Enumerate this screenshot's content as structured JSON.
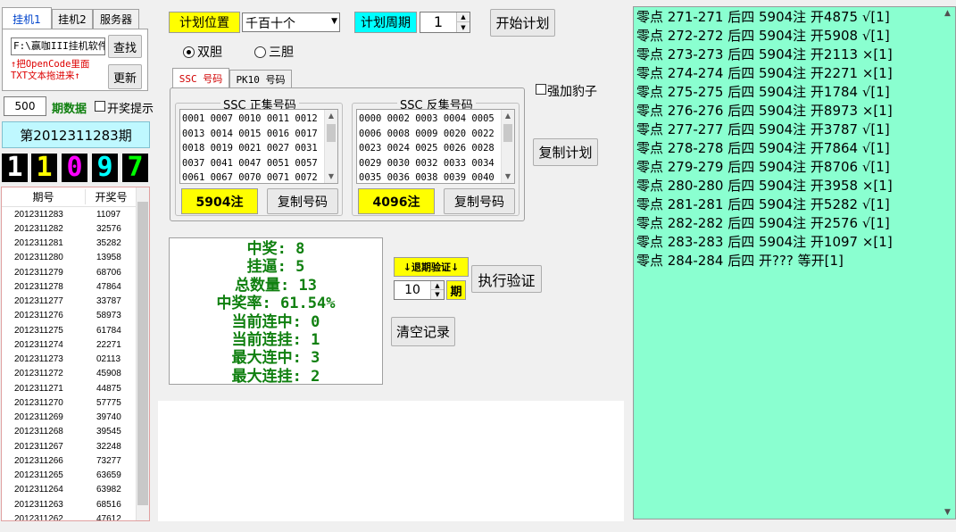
{
  "tabs": [
    "挂机1",
    "挂机2",
    "服务器"
  ],
  "software_path": "F:\\赢咖III挂机软件",
  "find_button": "查找",
  "update_button": "更新",
  "drag_hint_line1": "↑把OpenCode里面",
  "drag_hint_line2": "TXT文本拖进来↑",
  "period_count": "500",
  "period_data_label": "期数据",
  "lottery_hint_label": "开奖提示",
  "current_period": "第2012311283期",
  "digits": [
    "1",
    "1",
    "0",
    "9",
    "7"
  ],
  "digit_colors": [
    "#ffffff",
    "#ffff00",
    "#ff00ff",
    "#00ffff",
    "#00ff00"
  ],
  "history": {
    "headers": [
      "期号",
      "开奖号"
    ],
    "rows": [
      [
        "2012311283",
        "11097"
      ],
      [
        "2012311282",
        "32576"
      ],
      [
        "2012311281",
        "35282"
      ],
      [
        "2012311280",
        "13958"
      ],
      [
        "2012311279",
        "68706"
      ],
      [
        "2012311278",
        "47864"
      ],
      [
        "2012311277",
        "33787"
      ],
      [
        "2012311276",
        "58973"
      ],
      [
        "2012311275",
        "61784"
      ],
      [
        "2012311274",
        "22271"
      ],
      [
        "2012311273",
        "02113"
      ],
      [
        "2012311272",
        "45908"
      ],
      [
        "2012311271",
        "44875"
      ],
      [
        "2012311270",
        "57775"
      ],
      [
        "2012311269",
        "39740"
      ],
      [
        "2012311268",
        "39545"
      ],
      [
        "2012311267",
        "32248"
      ],
      [
        "2012311266",
        "73277"
      ],
      [
        "2012311265",
        "63659"
      ],
      [
        "2012311264",
        "63982"
      ],
      [
        "2012311263",
        "68516"
      ],
      [
        "2012311262",
        "47612"
      ]
    ]
  },
  "plan_position_label": "计划位置",
  "plan_position_value": "千百十个",
  "plan_period_label": "计划周期",
  "plan_period_value": "1",
  "start_plan_button": "开始计划",
  "radio_double": "双胆",
  "radio_triple": "三胆",
  "code_tabs": [
    "SSC 号码",
    "PK10 号码"
  ],
  "force_leopard": "强加豹子",
  "positive_set": {
    "title": "SSC 正集号码",
    "rows": [
      "0001 0007 0010 0011 0012",
      "0013 0014 0015 0016 0017",
      "0018 0019 0021 0027 0031",
      "0037 0041 0047 0051 0057",
      "0061 0067 0070 0071 0072"
    ],
    "count": "5904注",
    "copy_button": "复制号码"
  },
  "negative_set": {
    "title": "SSC 反集号码",
    "rows": [
      "0000 0002 0003 0004 0005",
      "0006 0008 0009 0020 0022",
      "0023 0024 0025 0026 0028",
      "0029 0030 0032 0033 0034",
      "0035 0036 0038 0039 0040"
    ],
    "count": "4096注",
    "copy_button": "复制号码"
  },
  "copy_plan_button": "复制计划",
  "stats": [
    "中奖: 8",
    "挂逼: 5",
    "总数量: 13",
    "中奖率: 61.54%",
    "当前连中: 0",
    "当前连挂: 1",
    "最大连中: 3",
    "最大连挂: 2"
  ],
  "backtest_label": "↓退期验证↓",
  "backtest_periods": "10",
  "backtest_unit": "期",
  "run_verify_button": "执行验证",
  "clear_records_button": "清空记录",
  "log": [
    "零点 271-271 后四 5904注 开4875 √[1]",
    "零点 272-272 后四 5904注 开5908 √[1]",
    "零点 273-273 后四 5904注 开2113 ×[1]",
    "零点 274-274 后四 5904注 开2271 ×[1]",
    "零点 275-275 后四 5904注 开1784 √[1]",
    "零点 276-276 后四 5904注 开8973 ×[1]",
    "零点 277-277 后四 5904注 开3787 √[1]",
    "零点 278-278 后四 5904注 开7864 √[1]",
    "零点 279-279 后四 5904注 开8706 √[1]",
    "零点 280-280 后四 5904注 开3958 ×[1]",
    "零点 281-281 后四 5904注 开5282 √[1]",
    "零点 282-282 后四 5904注 开2576 √[1]",
    "零点 283-283 后四 5904注 开1097 ×[1]",
    "零点 284-284 后四 开???  等开[1]"
  ],
  "colors": {
    "log_bg": "#8affd0",
    "highlight_yellow": "#ffff00",
    "highlight_cyan": "#00ffff",
    "stats_green": "#108010"
  }
}
